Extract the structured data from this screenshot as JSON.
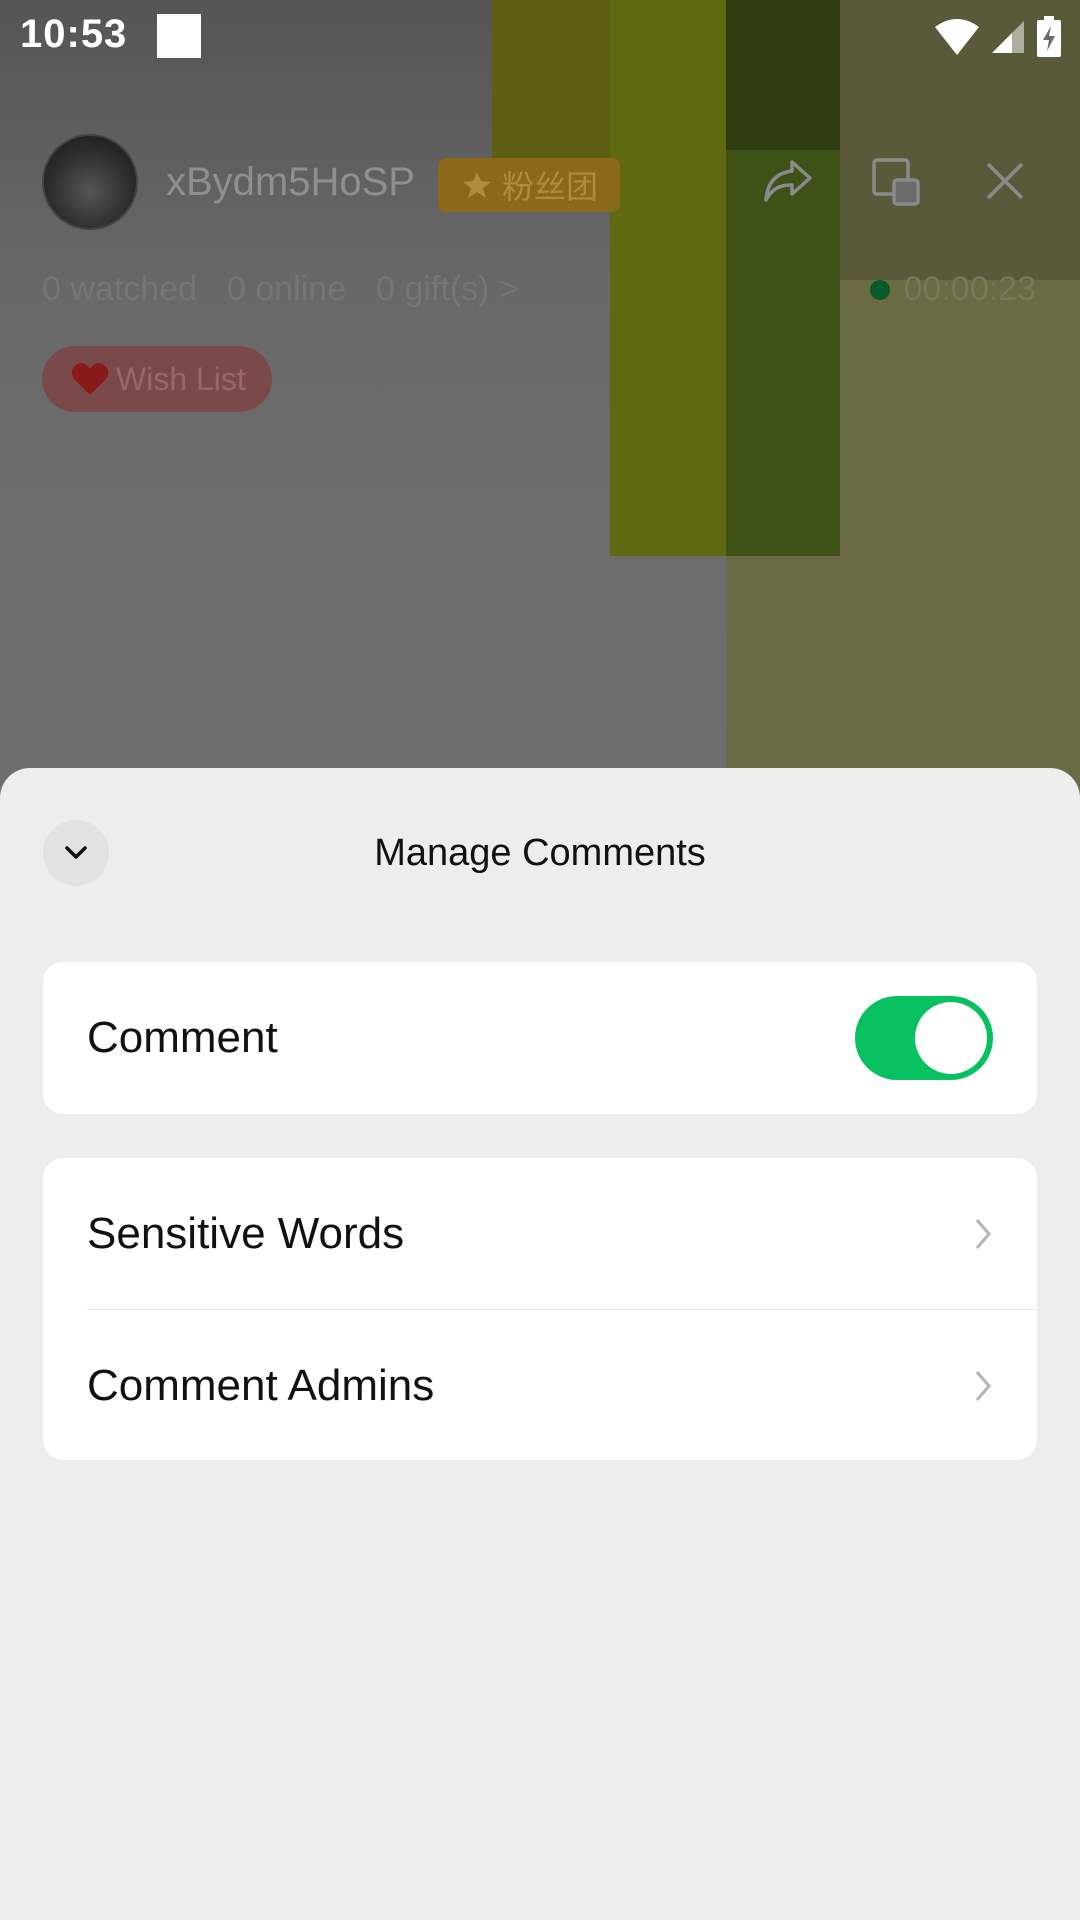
{
  "status_bar": {
    "time": "10:53"
  },
  "live": {
    "username": "xBydm5HoSP",
    "fan_badge": "粉丝团",
    "stats": {
      "watched": "0 watched",
      "online": "0 online",
      "gifts": "0 gift(s) >"
    },
    "timer": "00:00:23",
    "wish_list": "Wish List"
  },
  "sheet": {
    "title": "Manage Comments",
    "comment_row": {
      "label": "Comment",
      "enabled": true
    },
    "menu": [
      {
        "label": "Sensitive Words"
      },
      {
        "label": "Comment Admins"
      }
    ]
  },
  "colors": {
    "accent": "#07c160",
    "sheet_bg": "#ededed"
  },
  "icons": [
    "wifi-icon",
    "cell-signal-icon",
    "battery-charging-icon",
    "share-icon",
    "minimize-window-icon",
    "close-icon",
    "collapse-chevron-icon",
    "chevron-right-icon",
    "heart-icon",
    "fan-badge-icon"
  ]
}
